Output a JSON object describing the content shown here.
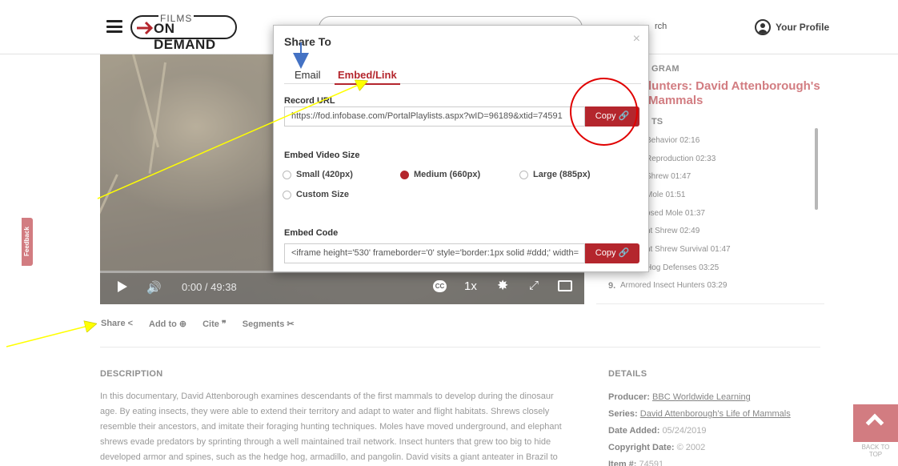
{
  "header": {
    "logo_top": "FILMS",
    "logo_bottom": "ON DEMAND",
    "advanced_search": "rch",
    "profile_label": "Your Profile"
  },
  "player": {
    "time": "0:00  / 49:38",
    "cc": "CC",
    "speed": "1x"
  },
  "actions": [
    {
      "label": "Share",
      "icon": "share-icon"
    },
    {
      "label": "Add to",
      "icon": "plus-circle-icon"
    },
    {
      "label": "Cite",
      "icon": "quote-icon"
    },
    {
      "label": "Segments",
      "icon": "scissors-icon"
    }
  ],
  "description": {
    "title": "DESCRIPTION",
    "text": "In this documentary, David Attenborough examines descendants of the first mammals to develop during the dinosaur\nage. By eating insects, they were able to extend their territory and adapt to water and flight habitats. Shrews closely\nresemble their ancestors, and imitate their foraging hunting techniques. Moles have moved underground, and elephant\nshrews evade predators by sprinting through a well maintained trail network. Insect hunters that grew too big to hide\ndeveloped armor and spines, such as the hedge hog, armadillo, and pangolin. David visits a giant anteater in Brazil to\nlearn about its termite harvesting strategy, and observes bats using sonar to detect prey in flight. Finally, he meets a"
  },
  "details": {
    "title": "DETAILS",
    "producer_label": "Producer:",
    "producer": "BBC Worldwide Learning",
    "series_label": "Series:",
    "series": "David Attenborough's Life of Mammals",
    "date_added_label": "Date Added:",
    "date_added": "05/24/2019",
    "copyright_label": "Copyright Date:",
    "copyright": "© 2002",
    "item_label": "Item #:",
    "item": "74591"
  },
  "program": {
    "heading": "GRAM",
    "title_line1": "lunters: David Attenborough's",
    "title_line2": "Mammals",
    "segments_heading": "TS",
    "segments": [
      {
        "num": "",
        "label": "Behavior 02:16"
      },
      {
        "num": "",
        "label": "Reproduction 02:33"
      },
      {
        "num": "",
        "label": "Shrew 01:47"
      },
      {
        "num": "",
        "label": "Mole 01:51"
      },
      {
        "num": "",
        "label": "osed Mole 01:37"
      },
      {
        "num": "",
        "label": "nt Shrew 02:49"
      },
      {
        "num": "",
        "label": "nt Shrew Survival 01:47"
      },
      {
        "num": "",
        "label": "Hog Defenses 03:25"
      },
      {
        "num": "9.",
        "label": "Armored Insect Hunters 03:29"
      }
    ]
  },
  "feedback_label": "Feedback",
  "back_to_top": "BACK TO\nTOP",
  "modal": {
    "title": "Share To",
    "close": "×",
    "tab_email": "Email",
    "tab_embed": "Embed/Link",
    "record_url_label": "Record URL",
    "record_url": "https://fod.infobase.com/PortalPlaylists.aspx?wID=96189&xtid=74591",
    "copy_label": "Copy",
    "embed_size_label": "Embed Video Size",
    "sizes": [
      {
        "label": "Small (420px)",
        "checked": false
      },
      {
        "label": "Medium (660px)",
        "checked": true
      },
      {
        "label": "Large (885px)",
        "checked": false
      },
      {
        "label": "Custom Size",
        "checked": false
      }
    ],
    "embed_code_label": "Embed Code",
    "embed_code": "<iframe height='530' frameborder='0' style='border:1px solid #ddd;' width="
  },
  "colors": {
    "brand_red": "#b4262d",
    "annotation_red": "#e00000",
    "annotation_yellow": "#ffff00",
    "annotation_blue": "#4472c4"
  }
}
